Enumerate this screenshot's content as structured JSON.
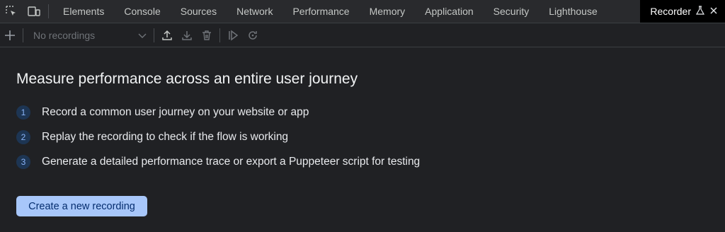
{
  "tabs": [
    {
      "label": "Elements"
    },
    {
      "label": "Console"
    },
    {
      "label": "Sources"
    },
    {
      "label": "Network"
    },
    {
      "label": "Performance"
    },
    {
      "label": "Memory"
    },
    {
      "label": "Application"
    },
    {
      "label": "Security"
    },
    {
      "label": "Lighthouse"
    }
  ],
  "active_tab": {
    "label": "Recorder"
  },
  "toolbar": {
    "recording_select_value": "No recordings",
    "icons": [
      "add-icon",
      "chevron-down-icon",
      "upload-icon",
      "download-icon",
      "delete-icon",
      "replay-icon",
      "redo-icon"
    ]
  },
  "main": {
    "heading": "Measure performance across an entire user journey",
    "steps": [
      {
        "num": "1",
        "text": "Record a common user journey on your website or app"
      },
      {
        "num": "2",
        "text": "Replay the recording to check if the flow is working"
      },
      {
        "num": "3",
        "text": "Generate a detailed performance trace or export a Puppeteer script for testing"
      }
    ],
    "button_label": "Create a new recording"
  },
  "colors": {
    "panel_bg": "#202124",
    "tabbar_bg": "#292a2d",
    "active_tab_bg": "#000000",
    "accent_button": "#a8c7fa",
    "step_badge_bg": "#1d3553"
  }
}
